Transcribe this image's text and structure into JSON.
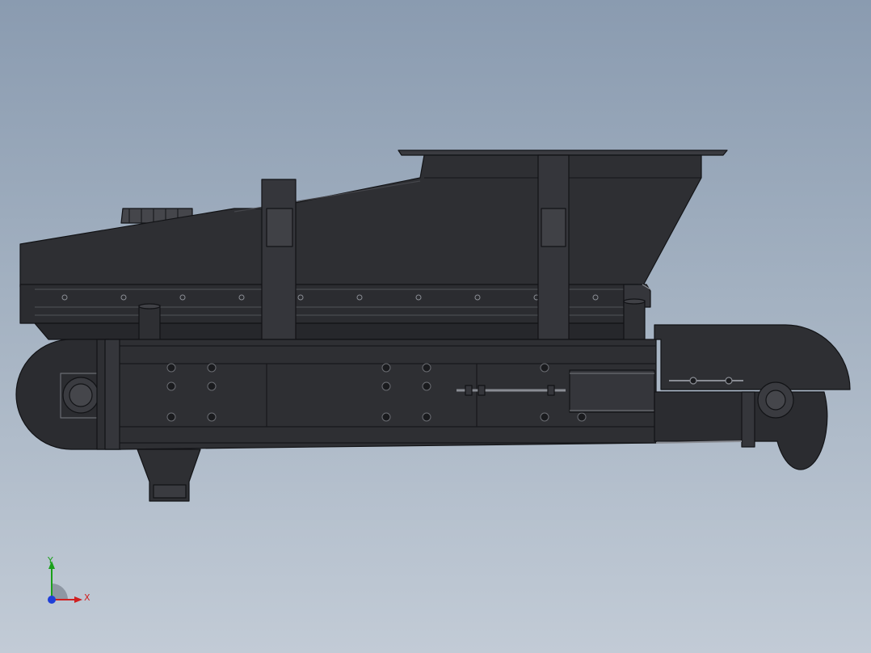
{
  "viewport": {
    "background_top": "#8a9bb0",
    "background_bottom": "#c2cbd6",
    "model_color": "#2e2f33"
  },
  "triad": {
    "y_label": "Y",
    "x_label": "X",
    "y_color": "#1aa01a",
    "x_color": "#d02020",
    "z_color": "#1f3fd8"
  }
}
